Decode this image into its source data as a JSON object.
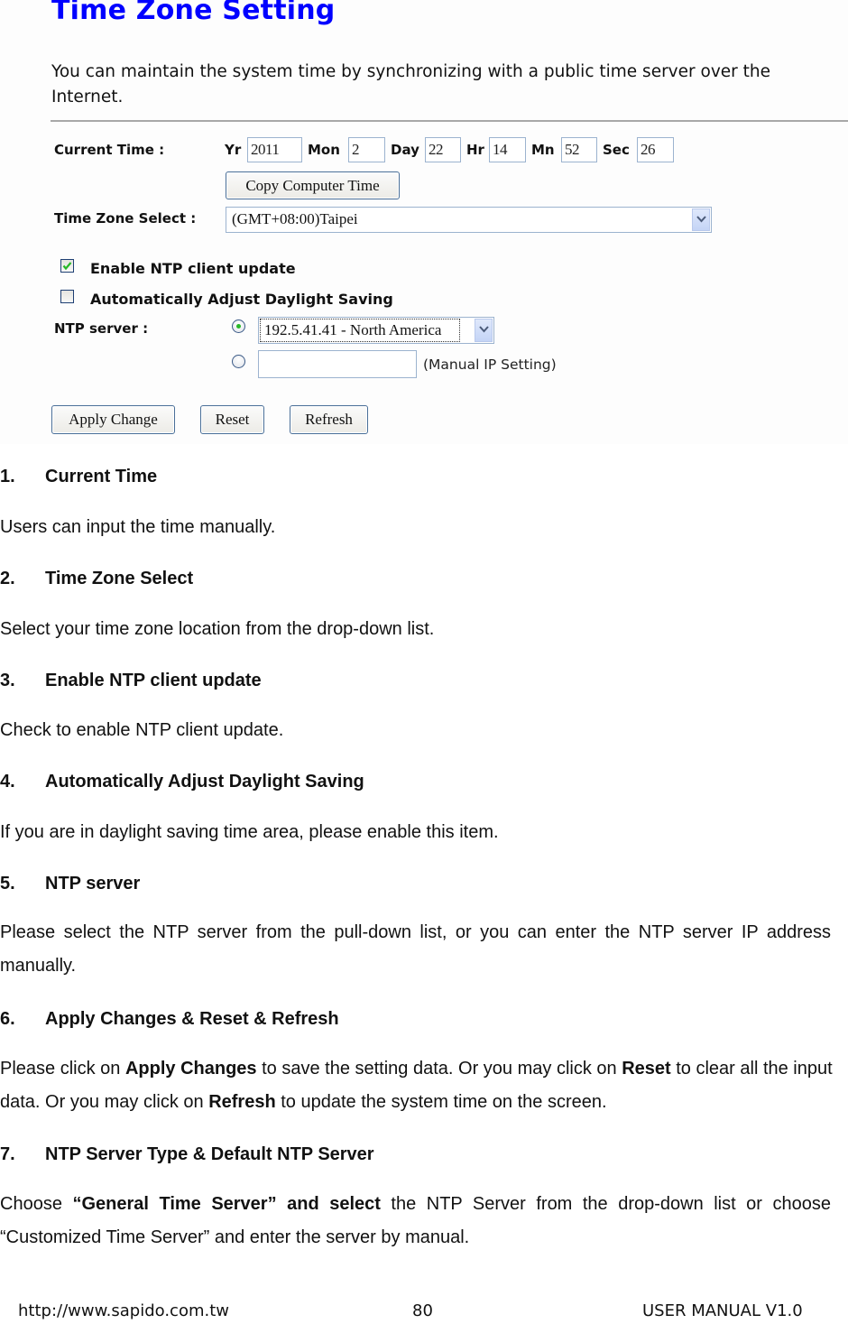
{
  "screenshot": {
    "title": "Time Zone Setting",
    "description": "You can maintain the system time by synchronizing with a public time server over the Internet.",
    "current_time": {
      "label": "Current Time :",
      "fields": [
        {
          "label": "Yr",
          "value": "2011"
        },
        {
          "label": "Mon",
          "value": "2"
        },
        {
          "label": "Day",
          "value": "22"
        },
        {
          "label": "Hr",
          "value": "14"
        },
        {
          "label": "Mn",
          "value": "52"
        },
        {
          "label": "Sec",
          "value": "26"
        }
      ],
      "copy_button": "Copy Computer Time"
    },
    "time_zone": {
      "label": "Time Zone Select :",
      "selected": "(GMT+08:00)Taipei"
    },
    "enable_ntp": {
      "label": "Enable NTP client update",
      "checked": true
    },
    "daylight_saving": {
      "label": "Automatically Adjust Daylight Saving",
      "checked": false
    },
    "ntp_server": {
      "label": "NTP server :",
      "preset_selected": true,
      "preset_value": "192.5.41.41 - North America",
      "manual_value": "",
      "manual_note": "(Manual IP Setting)"
    },
    "buttons": {
      "apply": "Apply Change",
      "reset": "Reset",
      "refresh": "Refresh"
    },
    "colors": {
      "title": "#0000ff",
      "check": "#27b827",
      "button_border": "#4a6f98",
      "input_border": "#9cb3cf"
    }
  },
  "sections": [
    {
      "num": "1.",
      "title": "Current Time",
      "text": "Users can input the time manually."
    },
    {
      "num": "2.",
      "title": "Time Zone Select",
      "text": "Select your time zone location from the drop-down list."
    },
    {
      "num": "3.",
      "title": "Enable NTP client update",
      "text": "Check to enable NTP client update."
    },
    {
      "num": "4.",
      "title": "Automatically Adjust Daylight Saving",
      "text": "If you are in daylight saving time area, please enable this item."
    },
    {
      "num": "5.",
      "title": "NTP server",
      "text": "Please select the NTP server from the pull-down list, or you can enter the NTP server IP address manually."
    },
    {
      "num": "6.",
      "title": "Apply Changes & Reset & Refresh",
      "text_parts": [
        "Please click on ",
        "Apply Changes",
        " to save the setting data. Or you may click on ",
        "Reset",
        " to clear all the input data. Or you may click on ",
        "Refresh",
        " to update the system time on the screen."
      ]
    },
    {
      "num": "7.",
      "title": "NTP Server Type & Default NTP Server",
      "text_parts": [
        "Choose ",
        "“General Time Server” and select",
        " the NTP Server from the drop-down list or choose “Customized Time Server” and enter the server by manual."
      ]
    }
  ],
  "footer": {
    "url": "http://www.sapido.com.tw",
    "page": "80",
    "manual": "USER MANUAL V1.0"
  }
}
